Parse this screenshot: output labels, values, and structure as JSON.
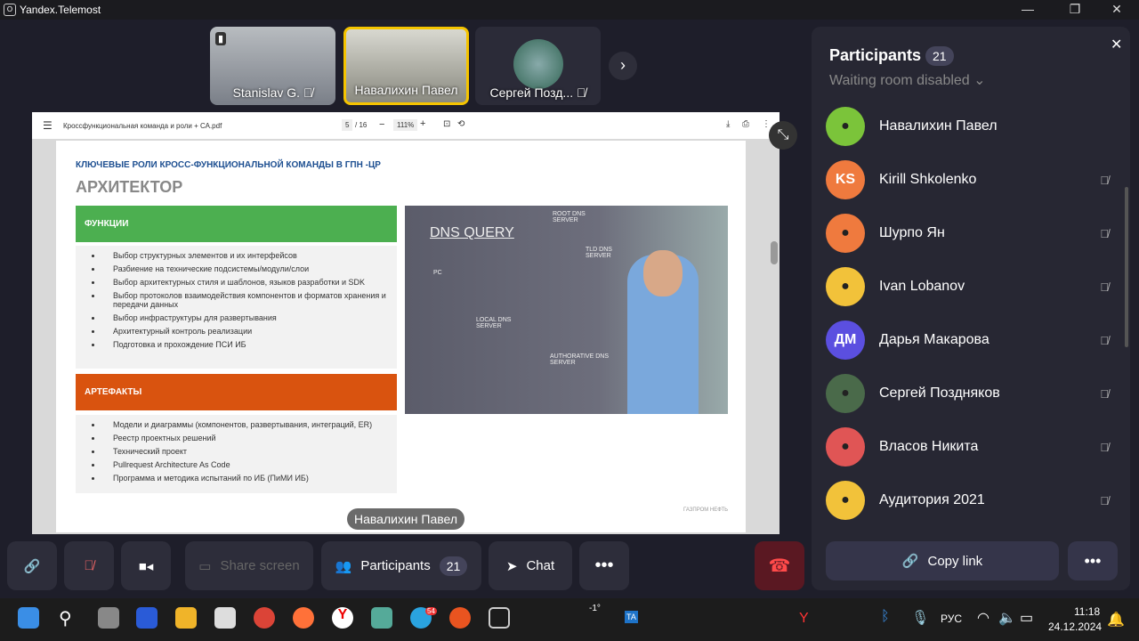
{
  "window": {
    "title": "Yandex.Telemost"
  },
  "videos": [
    {
      "name": "Stanislav G.",
      "muted": true,
      "active": false
    },
    {
      "name": "Навалихин Павел",
      "muted": false,
      "active": true
    },
    {
      "name": "Сергей Позд...",
      "muted": true,
      "active": false
    }
  ],
  "pdf": {
    "filename": "Кроссфункциональная команда и роли + СА.pdf",
    "page": "5",
    "total": "/ 16",
    "zoom": "111%",
    "slide": {
      "kicker": "КЛЮЧЕВЫЕ РОЛИ КРОСС-ФУНКЦИОНАЛЬНОЙ КОМАНДЫ В ГПН -ЦР",
      "title": "АРХИТЕКТОР",
      "functions_header": "ФУНКЦИИ",
      "functions": [
        "Выбор структурных элементов и их интерфейсов",
        "Разбиение на технические подсистемы/модули/слои",
        "Выбор архитектурных стиля и шаблонов, языков разработки и SDK",
        "Выбор протоколов взаимодействия компонентов и форматов хранения и передачи данных",
        "Выбор инфраструктуры для развертывания",
        "Архитектурный контроль реализации",
        "Подготовка и прохождение ПСИ ИБ"
      ],
      "artifacts_header": "АРТЕФАКТЫ",
      "artifacts": [
        "Модели и диаграммы (компонентов, развертывания, интеграций, ER)",
        "Реестр проектных решений",
        "Технический проект",
        "Pullrequest Architecture As Code",
        "Программа и методика испытаний по ИБ (ПиМИ ИБ)"
      ],
      "image_text": {
        "title": "DNS QUERY",
        "pc": "PC",
        "local": "LOCAL DNS SERVER",
        "root": "ROOT DNS SERVER",
        "tld": "TLD DNS SERVER",
        "auth": "AUTHORATIVE DNS SERVER"
      },
      "footer": "ГАЗПРОМ НЕФТЬ"
    }
  },
  "speaker_label": "Навалихин Павел",
  "controls": {
    "share": "Share screen",
    "participants": "Participants",
    "participants_count": "21",
    "chat": "Chat"
  },
  "panel": {
    "title": "Participants",
    "count": "21",
    "waiting": "Waiting room disabled",
    "copy_link": "Copy link",
    "participants": [
      {
        "name": "Навалихин Павел",
        "initials": "",
        "color": "#7bc43a",
        "muted": false
      },
      {
        "name": "Kirill Shkolenko",
        "initials": "KS",
        "color": "#ef7a3e",
        "muted": true
      },
      {
        "name": "Шурпо Ян",
        "initials": "",
        "color": "#ef7a3e",
        "muted": true
      },
      {
        "name": "Ivan Lobanov",
        "initials": "",
        "color": "#f2c23a",
        "muted": true
      },
      {
        "name": "Дарья Макарова",
        "initials": "ДМ",
        "color": "#5b4fe0",
        "muted": true
      },
      {
        "name": "Сергей Поздняков",
        "initials": "",
        "color": "#4a6a4a",
        "muted": true
      },
      {
        "name": "Власов Никита",
        "initials": "",
        "color": "#e05555",
        "muted": true
      },
      {
        "name": "Аудитория 2021",
        "initials": "",
        "color": "#f2c23a",
        "muted": true
      }
    ]
  },
  "taskbar": {
    "weather": "-1°",
    "telegram_badge": "54",
    "lang": "РУС",
    "time": "11:18",
    "date": "24.12.2024"
  }
}
